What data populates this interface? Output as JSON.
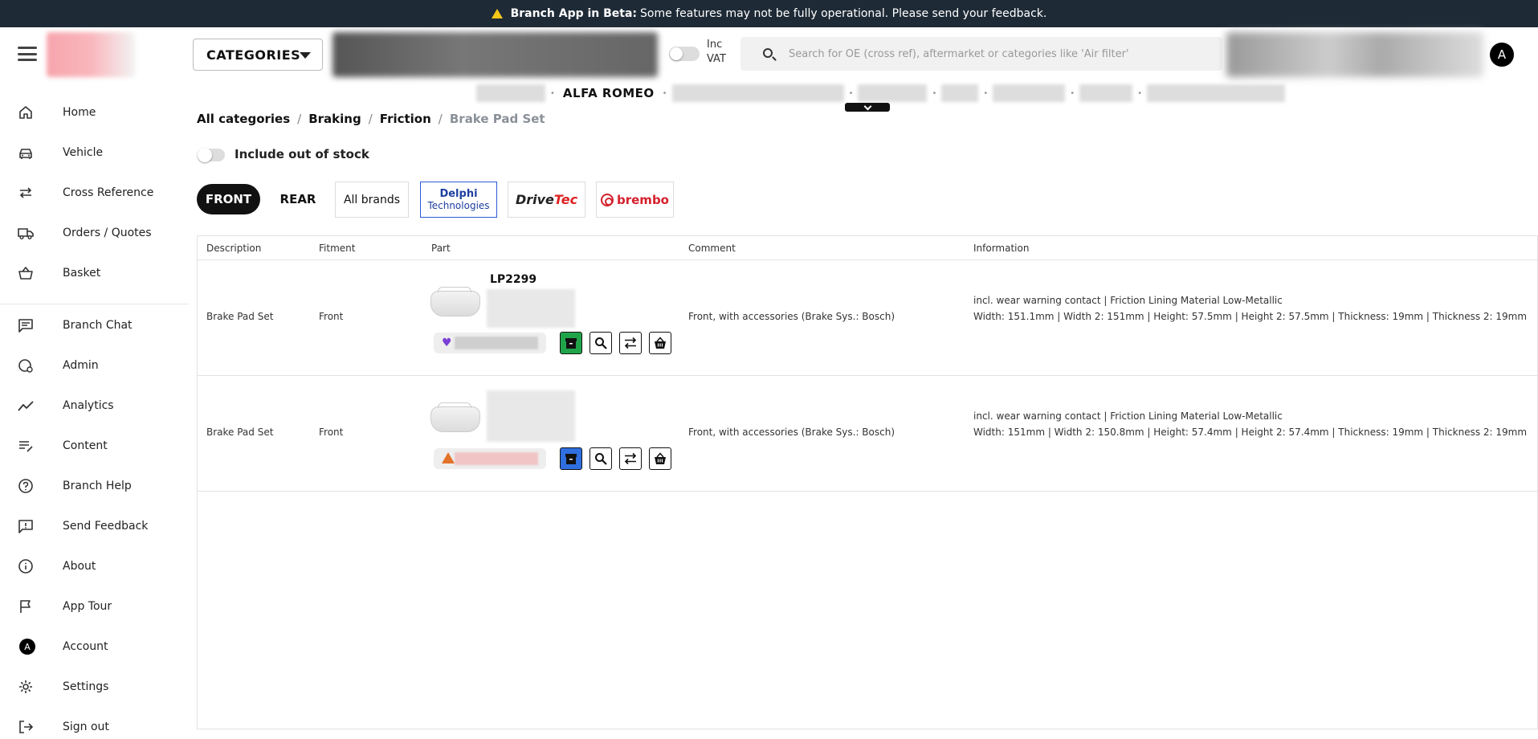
{
  "banner": {
    "strong": "Branch App in Beta:",
    "text": "Some features may not be fully operational. Please send your feedback."
  },
  "header": {
    "categories_label": "CATEGORIES",
    "vat_line1": "Inc",
    "vat_line2": "VAT",
    "search_placeholder": "Search for OE (cross ref), aftermarket or categories like 'Air filter'",
    "avatar_initial": "A"
  },
  "vehicle": {
    "make": "ALFA ROMEO"
  },
  "sidebar": {
    "items": [
      {
        "label": "Home",
        "icon": "home-icon"
      },
      {
        "label": "Vehicle",
        "icon": "car-icon"
      },
      {
        "label": "Cross Reference",
        "icon": "swap-icon"
      },
      {
        "label": "Orders / Quotes",
        "icon": "truck-icon"
      },
      {
        "label": "Basket",
        "icon": "basket-icon"
      },
      {
        "label": "Branch Chat",
        "icon": "chat-icon"
      },
      {
        "label": "Admin",
        "icon": "admin-icon"
      },
      {
        "label": "Analytics",
        "icon": "analytics-icon"
      },
      {
        "label": "Content",
        "icon": "content-icon"
      },
      {
        "label": "Branch Help",
        "icon": "help-icon"
      },
      {
        "label": "Send Feedback",
        "icon": "feedback-icon"
      },
      {
        "label": "About",
        "icon": "info-icon"
      },
      {
        "label": "App Tour",
        "icon": "flag-icon"
      },
      {
        "label": "Account",
        "icon": "account-avatar",
        "initial": "A"
      },
      {
        "label": "Settings",
        "icon": "gear-icon"
      },
      {
        "label": "Sign out",
        "icon": "sign-out-icon"
      }
    ]
  },
  "breadcrumb": {
    "items": [
      "All categories",
      "Braking",
      "Friction"
    ],
    "current": "Brake Pad Set"
  },
  "filters": {
    "out_of_stock_label": "Include out of stock",
    "position_front": "FRONT",
    "position_rear": "REAR",
    "all_brands": "All brands",
    "brand_delphi_line1": "Delphi",
    "brand_delphi_line2": "Technologies",
    "brand_drivetec_a": "Drive",
    "brand_drivetec_b": "Tec",
    "brand_brembo": "brembo"
  },
  "table": {
    "headers": [
      "Description",
      "Fitment",
      "Part",
      "Comment",
      "Information"
    ],
    "rows": [
      {
        "description": "Brake Pad Set",
        "fitment": "Front",
        "part_number": "LP2299",
        "comment": "Front, with accessories (Brake Sys.: Bosch)",
        "info_line1": "incl. wear warning contact | Friction Lining Material Low-Metallic",
        "info_line2": "Width: 151.1mm | Width 2: 151mm | Height: 57.5mm | Height 2: 57.5mm | Thickness: 19mm | Thickness 2: 19mm",
        "stock_icon": "heart-icon"
      },
      {
        "description": "Brake Pad Set",
        "fitment": "Front",
        "part_number": "",
        "comment": "Front, with accessories (Brake Sys.: Bosch)",
        "info_line1": "incl. wear warning contact | Friction Lining Material Low-Metallic",
        "info_line2": "Width: 151mm | Width 2: 150.8mm | Height: 57.4mm | Height 2: 57.4mm | Thickness: 19mm | Thickness 2: 19mm",
        "stock_icon": "warning-icon"
      }
    ]
  },
  "colors": {
    "banner_bg": "#1e2a36",
    "archive_green": "#20a44a",
    "archive_blue": "#2f6fe0",
    "brembo_red": "#d4202c",
    "delphi_blue": "#1d3f9e"
  }
}
